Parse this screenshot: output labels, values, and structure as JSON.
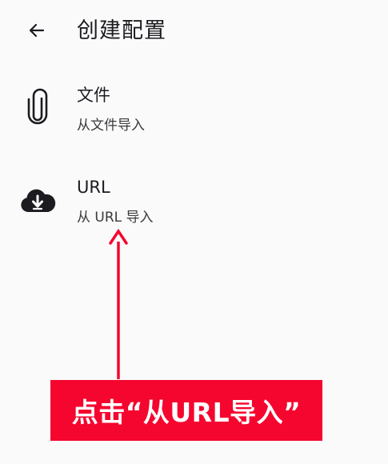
{
  "header": {
    "title": "创建配置",
    "back_icon": "arrow-left-icon"
  },
  "items": [
    {
      "title": "文件",
      "subtitle": "从文件导入",
      "icon": "paperclip-icon"
    },
    {
      "title": "URL",
      "subtitle": "从 URL 导入",
      "icon": "cloud-download-icon"
    }
  ],
  "annotation": {
    "label": "点击“从URL导入”",
    "color": "#f5062f"
  }
}
